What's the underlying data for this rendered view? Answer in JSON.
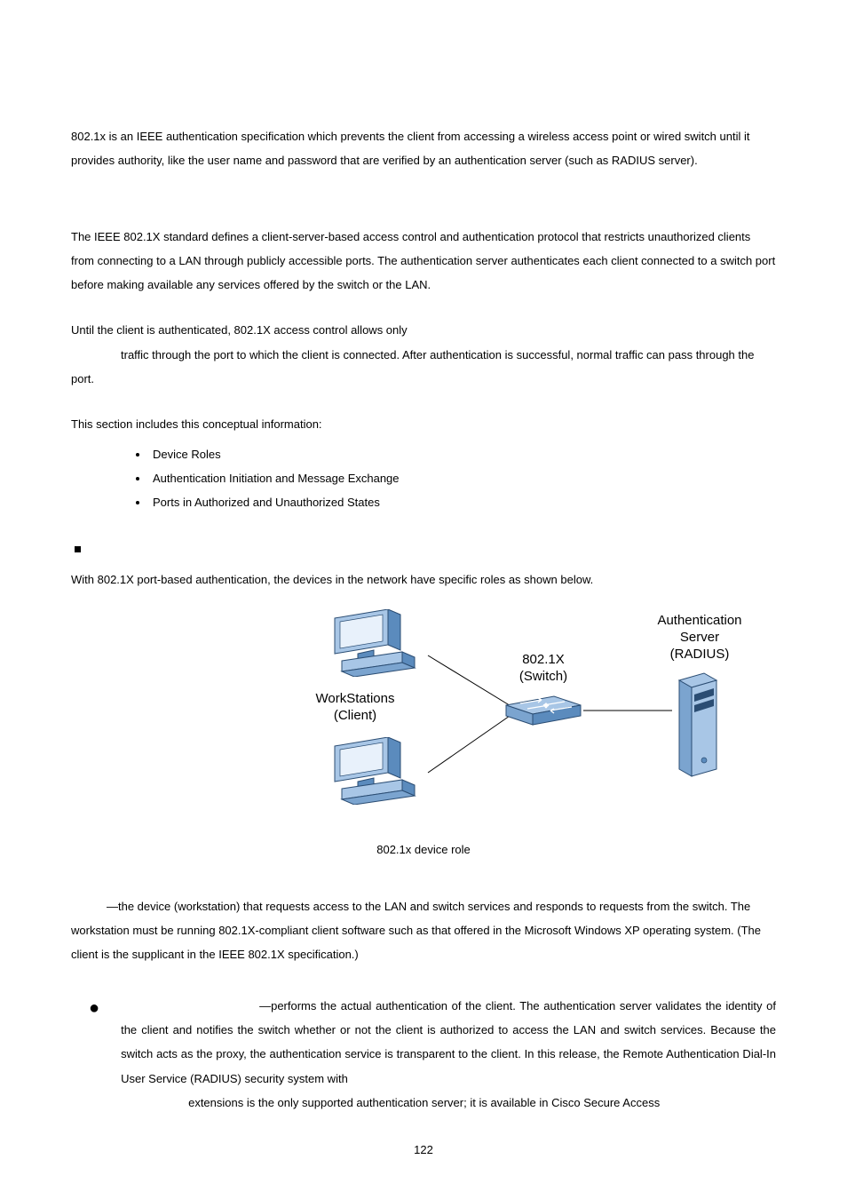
{
  "para1": "802.1x is an IEEE authentication specification which prevents the client from accessing a wireless access point or wired switch until it provides authority, like the user name and password that are verified by an authentication server (such as RADIUS server).",
  "para2": "The IEEE 802.1X standard defines a client-server-based access control and authentication protocol that restricts unauthorized clients from connecting to a LAN through publicly accessible ports. The authentication server authenticates each client connected to a switch port before making available any services offered by the switch or the LAN.",
  "para3_a": "Until the client is authenticated, 802.1X access control allows only",
  "para3_b": "traffic through the port to which the client is connected. After authentication is successful, normal traffic can pass through the port.",
  "para4": "This section includes this conceptual information:",
  "bullets_round": [
    "Device Roles",
    "Authentication Initiation and Message Exchange",
    "Ports in Authorized and Unauthorized States"
  ],
  "para5": "With 802.1X port-based authentication, the devices in the network have specific roles as shown below.",
  "figure": {
    "workstations": "WorkStations\n(Client)",
    "switch": "802.1X\n(Switch)",
    "server": "Authentication\nServer\n(RADIUS)",
    "caption": "802.1x device role"
  },
  "para6": "—the device (workstation) that requests access to the LAN and switch services and responds to requests from the switch. The workstation must be running 802.1X-compliant client software such as that offered in the Microsoft Windows XP operating system. (The client is the supplicant in the IEEE 802.1X specification.)",
  "para7_a": "—performs the actual authentication of the client. The authentication server validates the identity of the client and notifies the switch whether or not the client is authorized to access the LAN and switch services. Because the switch acts as the proxy, the authentication service is transparent to the client. In this release, the Remote Authentication Dial-In User Service (RADIUS) security system with",
  "para7_b": "extensions is the only supported authentication server; it is available in Cisco Secure Access",
  "page_number": "122"
}
